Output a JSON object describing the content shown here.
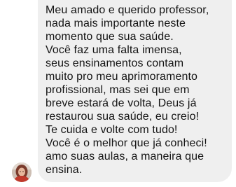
{
  "message": {
    "lines": [
      "Meu amado e querido professor,",
      "nada mais importante neste",
      "momento que sua saúde.",
      "Você faz uma falta imensa,",
      "seus ensinamentos contam",
      "muito pro meu aprimoramento",
      "profissional, mas sei que em",
      "breve estará de volta, Deus já",
      "restaurou sua saúde, eu creio!",
      "Te cuida e volte com tudo!",
      "Você é o melhor que já conheci!",
      "amo suas aulas, a maneira que",
      "ensina."
    ],
    "bubble_color": "#efefef",
    "text_color": "#141414"
  },
  "sender": {
    "avatar": "avatar-photo"
  }
}
